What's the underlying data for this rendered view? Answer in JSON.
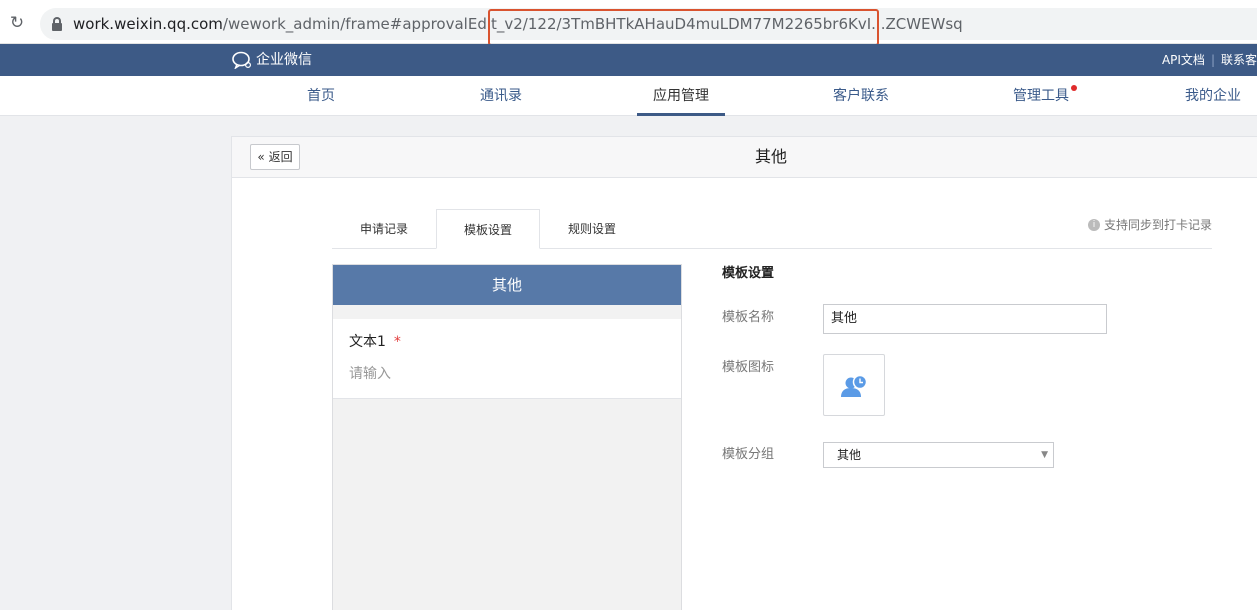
{
  "browser": {
    "reload_icon": "↻",
    "url_host": "work.weixin.qq.com",
    "url_path": "/wework_admin/frame#approvalEdit_v2/122/3TmBHTkAHauD4muLDM77M2265br6KvI...ZCWEWsq"
  },
  "header": {
    "brand": "企业微信",
    "links": [
      "API文档",
      "联系客"
    ]
  },
  "nav": {
    "items": [
      "首页",
      "通讯录",
      "应用管理",
      "客户联系",
      "管理工具",
      "我的企业"
    ],
    "active_index": 2
  },
  "page": {
    "back_label": "返回",
    "title": "其他"
  },
  "tabs": {
    "items": [
      "申请记录",
      "模板设置",
      "规则设置"
    ],
    "active_index": 1,
    "sync_note": "支持同步到打卡记录"
  },
  "preview": {
    "header": "其他",
    "field_label": "文本1",
    "required_mark": "*",
    "placeholder": "请输入"
  },
  "settings": {
    "section_title": "模板设置",
    "name_label": "模板名称",
    "name_value": "其他",
    "icon_label": "模板图标",
    "group_label": "模板分组",
    "group_value": "其他"
  },
  "colors": {
    "header_bg": "#3d5a86",
    "preview_header_bg": "#5779a8",
    "highlight_border": "#d9532f",
    "icon_blue": "#5b9be6"
  }
}
